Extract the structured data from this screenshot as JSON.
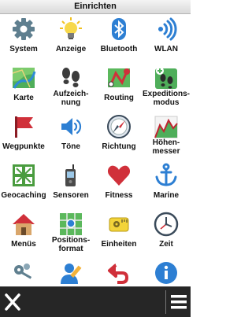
{
  "header": {
    "title": "Einrichten"
  },
  "menu": {
    "items": [
      {
        "label": "System",
        "icon": "gear-icon"
      },
      {
        "label": "Anzeige",
        "icon": "lightbulb-icon"
      },
      {
        "label": "Bluetooth",
        "icon": "bluetooth-icon"
      },
      {
        "label": "WLAN",
        "icon": "wifi-icon"
      },
      {
        "label": "Karte",
        "icon": "map-icon"
      },
      {
        "label": "Aufzeich-\nnung",
        "icon": "footprints-icon"
      },
      {
        "label": "Routing",
        "icon": "routing-icon"
      },
      {
        "label": "Expeditions-\nmodus",
        "icon": "expedition-icon"
      },
      {
        "label": "Wegpunkte",
        "icon": "flag-icon"
      },
      {
        "label": "Töne",
        "icon": "speaker-icon"
      },
      {
        "label": "Richtung",
        "icon": "compass-icon"
      },
      {
        "label": "Höhen-\nmesser",
        "icon": "altimeter-icon"
      },
      {
        "label": "Geocaching",
        "icon": "geocache-icon"
      },
      {
        "label": "Sensoren",
        "icon": "sensor-device-icon"
      },
      {
        "label": "Fitness",
        "icon": "heart-icon"
      },
      {
        "label": "Marine",
        "icon": "anchor-icon"
      },
      {
        "label": "Menüs",
        "icon": "house-icon"
      },
      {
        "label": "Positions-\nformat",
        "icon": "position-format-icon"
      },
      {
        "label": "Einheiten",
        "icon": "ruler-icon"
      },
      {
        "label": "Zeit",
        "icon": "clock-icon"
      },
      {
        "label": "",
        "icon": "keys-icon"
      },
      {
        "label": "",
        "icon": "user-edit-icon"
      },
      {
        "label": "",
        "icon": "reset-arrow-icon"
      },
      {
        "label": "",
        "icon": "info-icon"
      }
    ]
  },
  "footer": {
    "close": "close-icon",
    "menu": "hamburger-menu-icon"
  },
  "colors": {
    "header": "#dcdcdc",
    "footer": "#262626",
    "accent_blue": "#2d7fd3",
    "red": "#d0303a"
  }
}
